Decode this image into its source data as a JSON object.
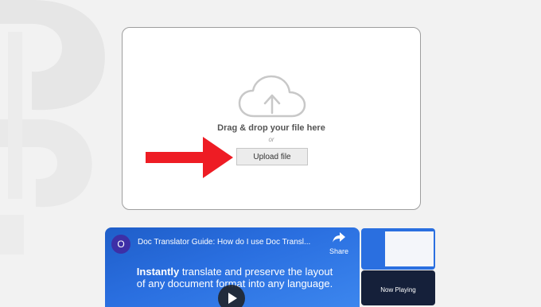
{
  "upload": {
    "drag_text": "Drag & drop your file here",
    "or_text": "or",
    "button_label": "Upload file"
  },
  "video": {
    "channel_initial": "O",
    "title": "Doc Translator Guide: How do I use Doc Transl...",
    "share_label": "Share",
    "caption_bold": "Instantly",
    "caption_rest": " translate and preserve the layout of any document format into any language."
  },
  "playlist": {
    "now_playing": "Now Playing"
  },
  "colors": {
    "arrow": "#ee1c24",
    "video_bg": "#2a6fe0"
  }
}
